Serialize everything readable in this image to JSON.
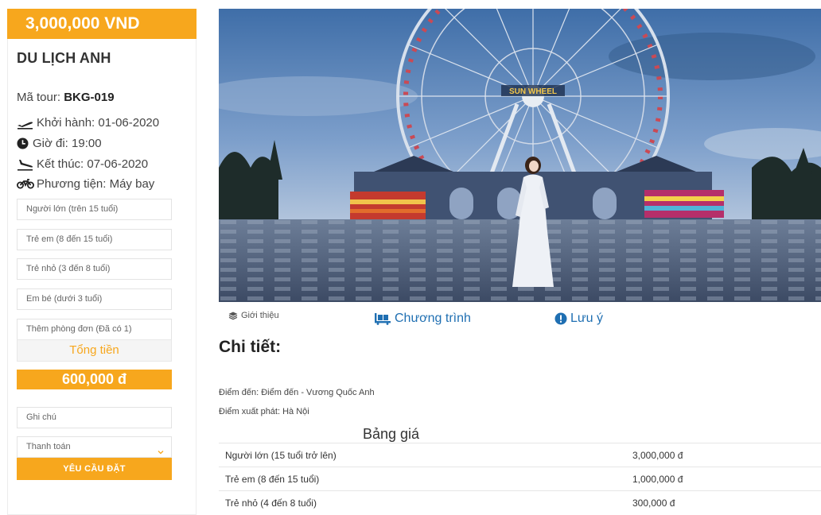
{
  "sidebar": {
    "price_banner": "3,000,000 VND",
    "tour_name": "DU LỊCH ANH",
    "tour_code_label": "Mã tour:",
    "tour_code": "BKG-019",
    "departure": "Khởi hành: 01-06-2020",
    "time": "Giờ đi: 19:00",
    "end": "Kết thúc: 07-06-2020",
    "transport": "Phương tiện: Máy bay",
    "fields": {
      "adult": "Người lớn (trên 15 tuổi)",
      "child": "Trẻ em (8 đến 15 tuổi)",
      "kid": "Trẻ nhỏ (3 đến 8 tuổi)",
      "baby": "Em bé (dưới 3 tuổi)",
      "single_room": "Thêm phòng đơn (Đã có 1)"
    },
    "total_label": "Tổng tiền",
    "total_value": "600,000 đ",
    "note_placeholder": "Ghi chú",
    "payment_selected": "Thanh toán",
    "submit_label": "YÊU CẦU ĐẶT"
  },
  "tabs": {
    "intro": "Giới thiệu",
    "program": "Chương trình",
    "note": "Lưu ý"
  },
  "hero": {
    "sign_text": "SUN WHEEL"
  },
  "details": {
    "title": "Chi tiết:",
    "destination": "Điểm đến: Điểm đến - Vương Quốc Anh",
    "origin": "Điểm xuất phát: Hà Nội",
    "price_table_title": "Bảng giá",
    "price_rows": [
      {
        "label": "Người lớn (15 tuổi trở lên)",
        "price": "3,000,000 đ"
      },
      {
        "label": "Trẻ em (8 đến 15 tuổi)",
        "price": "1,000,000 đ"
      },
      {
        "label": "Trẻ nhỏ (4 đến 8 tuổi)",
        "price": "300,000 đ"
      }
    ]
  },
  "colors": {
    "accent": "#f7a71d",
    "link": "#1f6fb2"
  }
}
